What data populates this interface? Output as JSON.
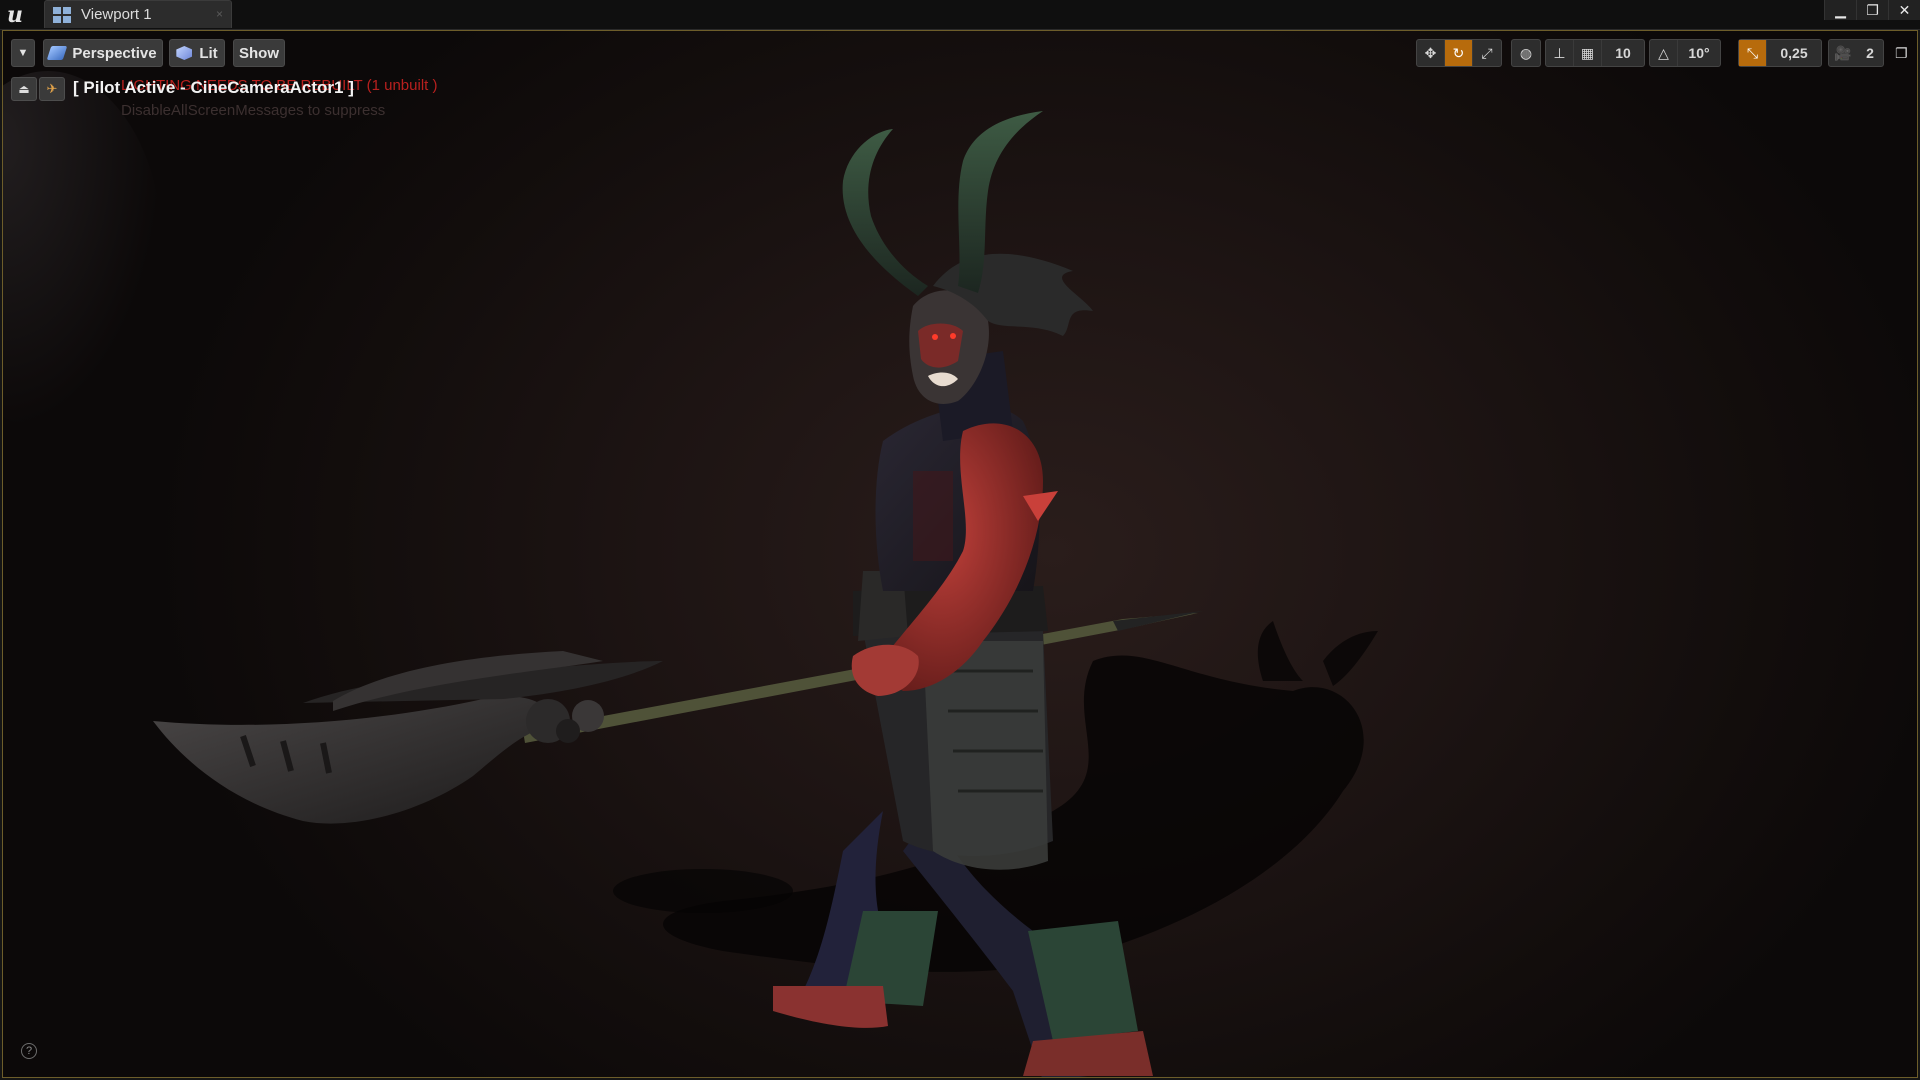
{
  "titlebar": {
    "logo": "u",
    "tab_label": "Viewport 1",
    "tab_close": "×",
    "minimize": "▁",
    "restore": "❐",
    "close": "✕"
  },
  "toolbar": {
    "dropdown": "▼",
    "perspective_label": "Perspective",
    "lit_label": "Lit",
    "show_label": "Show",
    "grid_snap_value": "10",
    "rotation_snap_value": "10°",
    "scale_snap_value": "0,25",
    "camera_speed_value": "2"
  },
  "pilot": {
    "label": "[ Pilot Active - CineCameraActor1 ]",
    "warning": "LIGHTING NEEDS TO BE REBUILT (1 unbuilt )",
    "hint": "DisableAllScreenMessages to suppress"
  },
  "help_icon": "?",
  "colors": {
    "active_accent": "#b76b0c",
    "viewport_border": "#6d5d2a",
    "warning_red": "#b8201e",
    "background": "#120d0c"
  },
  "icons": {
    "translate": "translate-icon",
    "rotate": "rotate-icon",
    "scale": "scale-icon",
    "world": "world-local-icon",
    "surface_snap": "surface-snap-icon",
    "grid": "grid-snap-icon",
    "angle": "rotation-snap-icon",
    "scale_snap": "scale-snap-icon",
    "camera_speed": "camera-speed-icon",
    "maximize": "maximize-viewport-icon"
  }
}
